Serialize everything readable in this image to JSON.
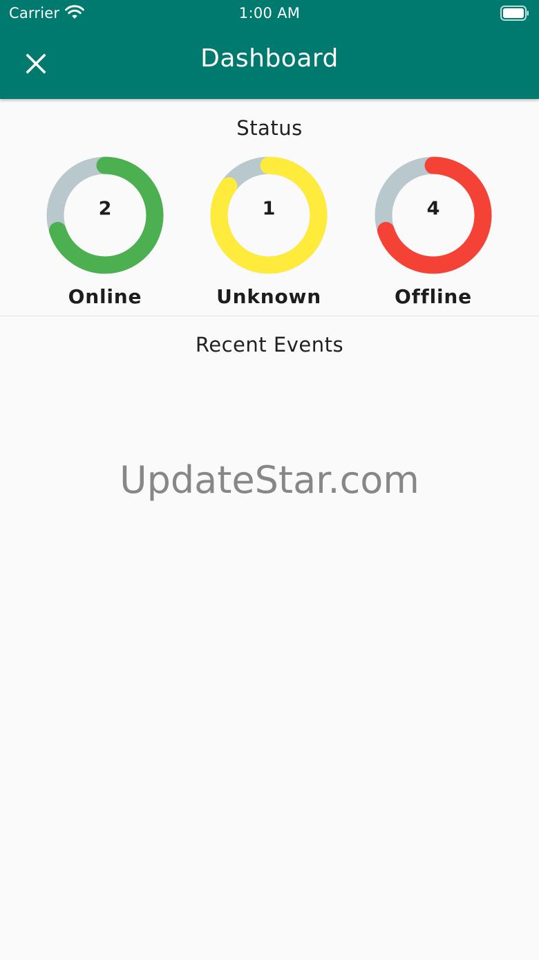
{
  "status_bar": {
    "carrier": "Carrier",
    "time": "1:00 AM",
    "wifi_icon": "wifi-icon",
    "battery_icon": "battery-icon"
  },
  "header": {
    "title": "Dashboard",
    "close_icon": "close-icon",
    "background_color": "#00796f"
  },
  "status_section": {
    "title": "Status",
    "items": [
      {
        "label": "Online",
        "count": "2",
        "level": 0.7,
        "color": "#4caf50"
      },
      {
        "label": "Unknown",
        "count": "1",
        "level": 0.85,
        "color": "#ffeb3b"
      },
      {
        "label": "Offline",
        "count": "4",
        "level": 0.7,
        "color": "#f44336"
      }
    ],
    "track_color": "#b9c8cc"
  },
  "events_section": {
    "title": "Recent Events"
  },
  "watermark": {
    "text": "UpdateStar.com"
  }
}
